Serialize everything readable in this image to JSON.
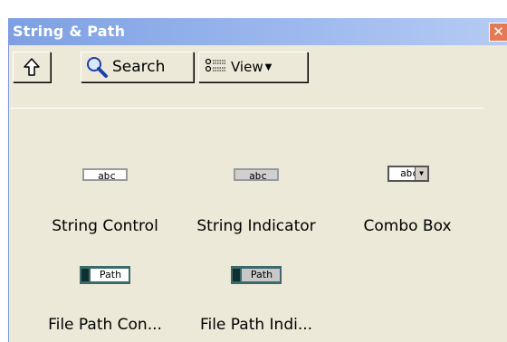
{
  "window": {
    "title": "String & Path",
    "close_glyph": "✕"
  },
  "toolbar": {
    "up_icon": "up-arrow-icon",
    "search_label": "Search",
    "view_label": "View",
    "view_arrow": "▼"
  },
  "items": [
    {
      "label": "String Control",
      "glyph_text": "abc"
    },
    {
      "label": "String Indicator",
      "glyph_text": "abc"
    },
    {
      "label": "Combo Box",
      "glyph_text": "abc"
    },
    {
      "label": "File Path Con...",
      "glyph_text": "Path"
    },
    {
      "label": "File Path Indi...",
      "glyph_text": "Path"
    }
  ],
  "colors": {
    "titlebar_start": "#7ea0e2",
    "titlebar_end": "#b5cbf3",
    "panel_bg": "#ece9d8",
    "close_button": "#e37a55"
  }
}
